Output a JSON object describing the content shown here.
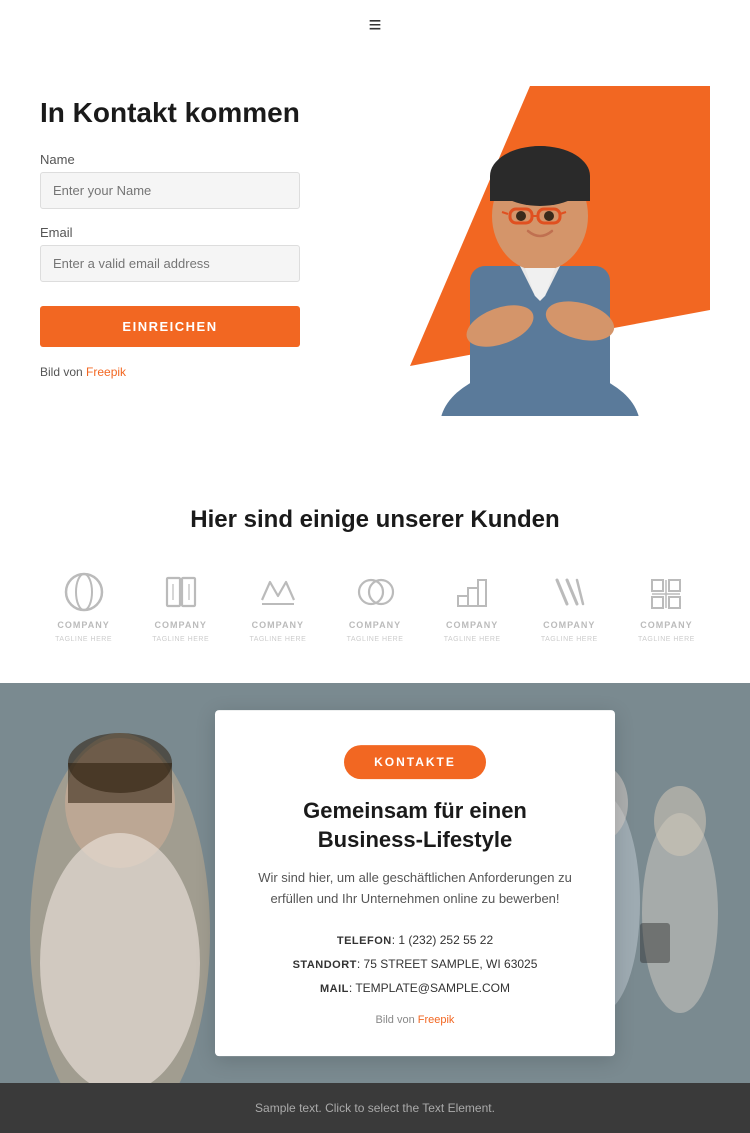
{
  "header": {
    "menu_icon": "≡"
  },
  "hero": {
    "title": "In Kontakt kommen",
    "name_label": "Name",
    "name_placeholder": "Enter your Name",
    "email_label": "Email",
    "email_placeholder": "Enter a valid email address",
    "submit_label": "EINREICHEN",
    "credit_text": "Bild von",
    "credit_link_text": "Freepik",
    "credit_link_href": "#"
  },
  "clients": {
    "title": "Hier sind einige unserer Kunden",
    "logos": [
      {
        "name": "COMPANY",
        "tagline": "TAGLINE HERE"
      },
      {
        "name": "COMPANY",
        "tagline": "TAGLINE HERE"
      },
      {
        "name": "COMPANY",
        "tagline": "TAGLINE HERE"
      },
      {
        "name": "COMPANY",
        "tagline": "TAGLINE HERE"
      },
      {
        "name": "COMPANY",
        "tagline": "TAGLINE HERE"
      },
      {
        "name": "COMPANY",
        "tagline": "TAGLINE HERE"
      },
      {
        "name": "COMPANY",
        "tagline": "TAGLINE HERE"
      }
    ]
  },
  "cta": {
    "button_label": "KONTAKTE",
    "title": "Gemeinsam für einen Business-Lifestyle",
    "description": "Wir sind hier, um alle geschäftlichen Anforderungen zu erfüllen und Ihr Unternehmen online zu bewerben!",
    "phone_label": "TELEFON",
    "phone_value": "1 (232) 252 55 22",
    "address_label": "STANDORT",
    "address_value": "75 STREET SAMPLE, WI 63025",
    "email_label": "MAIL",
    "email_value": "TEMPLATE@SAMPLE.COM",
    "credit_text": "Bild von",
    "credit_link_text": "Freepik",
    "credit_link_href": "#"
  },
  "footer": {
    "text": "Sample text. Click to select the Text Element."
  }
}
